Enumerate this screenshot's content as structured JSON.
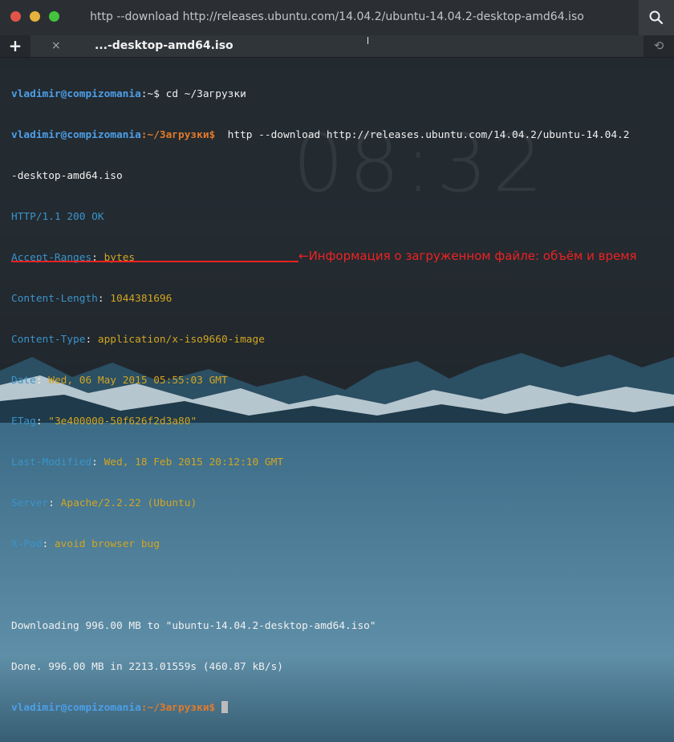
{
  "window": {
    "title": "http --download http://releases.ubuntu.com/14.04.2/ubuntu-14.04.2-desktop-amd64.iso"
  },
  "tab": {
    "label": "...-desktop-amd64.iso",
    "close_glyph": "×",
    "add_glyph": "+",
    "restore_glyph": "⟲"
  },
  "background": {
    "clock": "08:32"
  },
  "prompt": {
    "user": "vladimir@compizomania",
    "home_path": ":~$",
    "dl_path": ":~/Загрузки$"
  },
  "commands": {
    "cd": " cd ~/Загрузки",
    "http_1": "  http --download http://releases.ubuntu.com/14.04.2/ubuntu-14.04.2",
    "http_2": "-desktop-amd64.iso"
  },
  "response": {
    "status_proto": "HTTP",
    "status_rest": "/1.1 200 OK",
    "headers": [
      {
        "key": "Accept-Ranges",
        "value": "bytes"
      },
      {
        "key": "Content-Length",
        "value": "1044381696"
      },
      {
        "key": "Content-Type",
        "value": "application/x-iso9660-image"
      },
      {
        "key": "Date",
        "value": "Wed, 06 May 2015 05:55:03 GMT"
      },
      {
        "key": "ETag",
        "value": "\"3e400000-50f626f2d3a80\""
      },
      {
        "key": "Last-Modified",
        "value": "Wed, 18 Feb 2015 20:12:10 GMT"
      },
      {
        "key": "Server",
        "value": "Apache/2.2.22 (Ubuntu)"
      },
      {
        "key": "X-Pad",
        "value": "avoid browser bug"
      }
    ]
  },
  "download": {
    "progress_line": "Downloading 996.00 MB to \"ubuntu-14.04.2-desktop-amd64.iso\"",
    "done_line": "Done. 996.00 MB in 2213.01559s (460.87 kB/s)"
  },
  "annotation": {
    "text": "←Информация о загруженном файле: объём и время"
  },
  "colors": {
    "user": "#4d9fe8",
    "path": "#e27a2a",
    "header_key": "#3b93c8",
    "header_value": "#d2a522",
    "annotation": "#ee2222"
  }
}
